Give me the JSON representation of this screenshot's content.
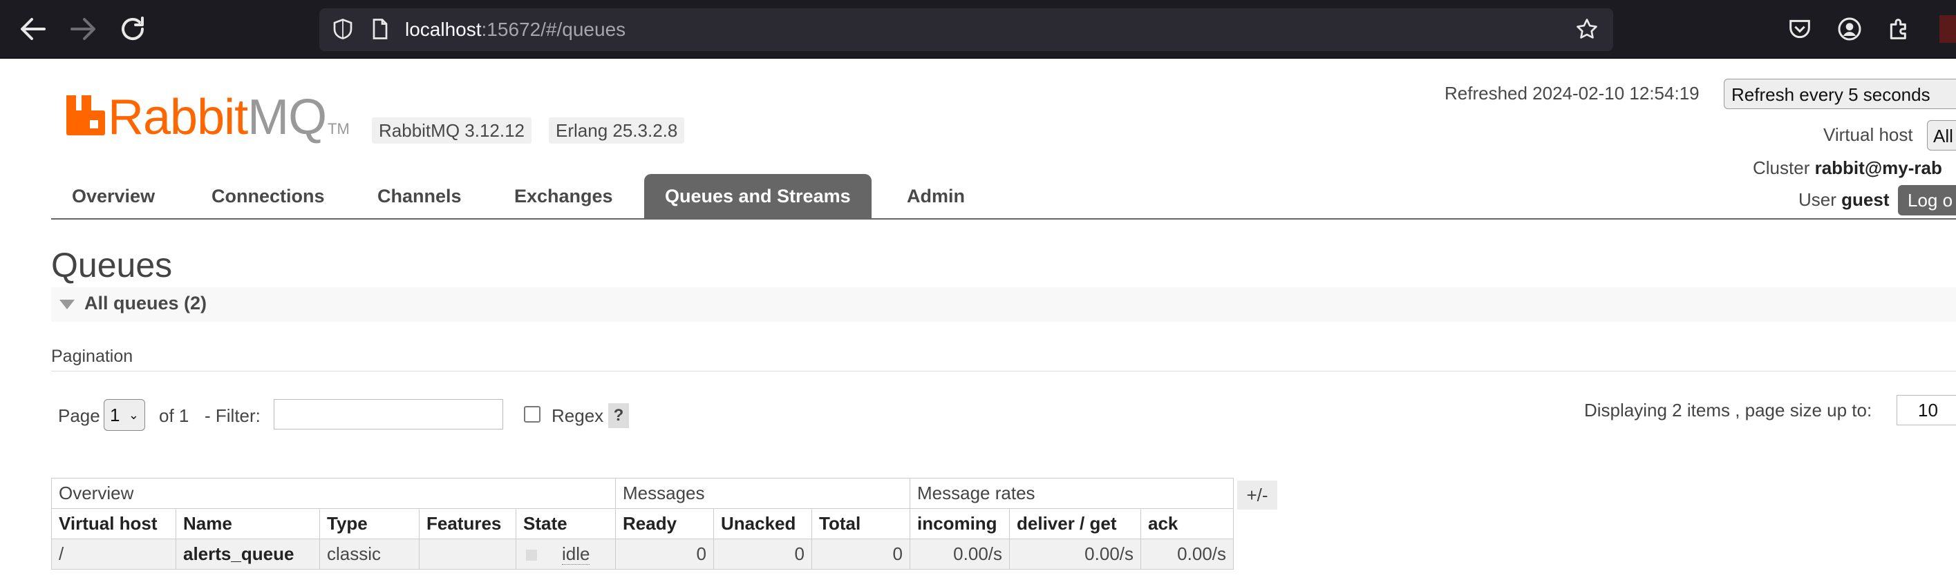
{
  "browser": {
    "url_host": "localhost",
    "url_rest": ":15672/#/queues",
    "icons": [
      "back-arrow-icon",
      "forward-arrow-icon",
      "reload-icon",
      "shield-icon",
      "page-icon",
      "star-icon",
      "pocket-icon",
      "account-icon",
      "extensions-icon"
    ]
  },
  "header": {
    "logo_rabbit": "Rabbit",
    "logo_mq": "MQ",
    "logo_tm": "TM",
    "rabbitmq_version": "RabbitMQ 3.12.12",
    "erlang_version": "Erlang 25.3.2.8",
    "refreshed": "Refreshed 2024-02-10 12:54:19",
    "refresh_select": "Refresh every 5 seconds",
    "vhost_label": "Virtual host",
    "vhost_value": "All",
    "cluster_label": "Cluster",
    "cluster_value": "rabbit@my-rab",
    "user_label": "User",
    "user_value": "guest",
    "logout": "Log o"
  },
  "tabs": [
    {
      "label": "Overview"
    },
    {
      "label": "Connections"
    },
    {
      "label": "Channels"
    },
    {
      "label": "Exchanges"
    },
    {
      "label": "Queues and Streams"
    },
    {
      "label": "Admin"
    }
  ],
  "main": {
    "title": "Queues",
    "section_title": "All queues (2)",
    "pagination_label": "Pagination",
    "page_label": "Page",
    "page_value": "1",
    "of_label": "of 1",
    "filter_label": "- Filter:",
    "regex_label": "Regex",
    "help": "?",
    "displaying": "Displaying 2 items , page size up to:",
    "page_size": "10"
  },
  "table": {
    "groups": [
      "Overview",
      "Messages",
      "Message rates"
    ],
    "columns": [
      "Virtual host",
      "Name",
      "Type",
      "Features",
      "State",
      "Ready",
      "Unacked",
      "Total",
      "incoming",
      "deliver / get",
      "ack"
    ],
    "rows": [
      {
        "vhost": "/",
        "name": "alerts_queue",
        "type": "classic",
        "features": "",
        "state": "idle",
        "ready": "0",
        "unacked": "0",
        "total": "0",
        "incoming": "0.00/s",
        "deliver": "0.00/s",
        "ack": "0.00/s"
      }
    ],
    "plusminus": "+/-"
  },
  "colors": {
    "brand_orange": "#ff6600",
    "tab_active": "#666666"
  }
}
